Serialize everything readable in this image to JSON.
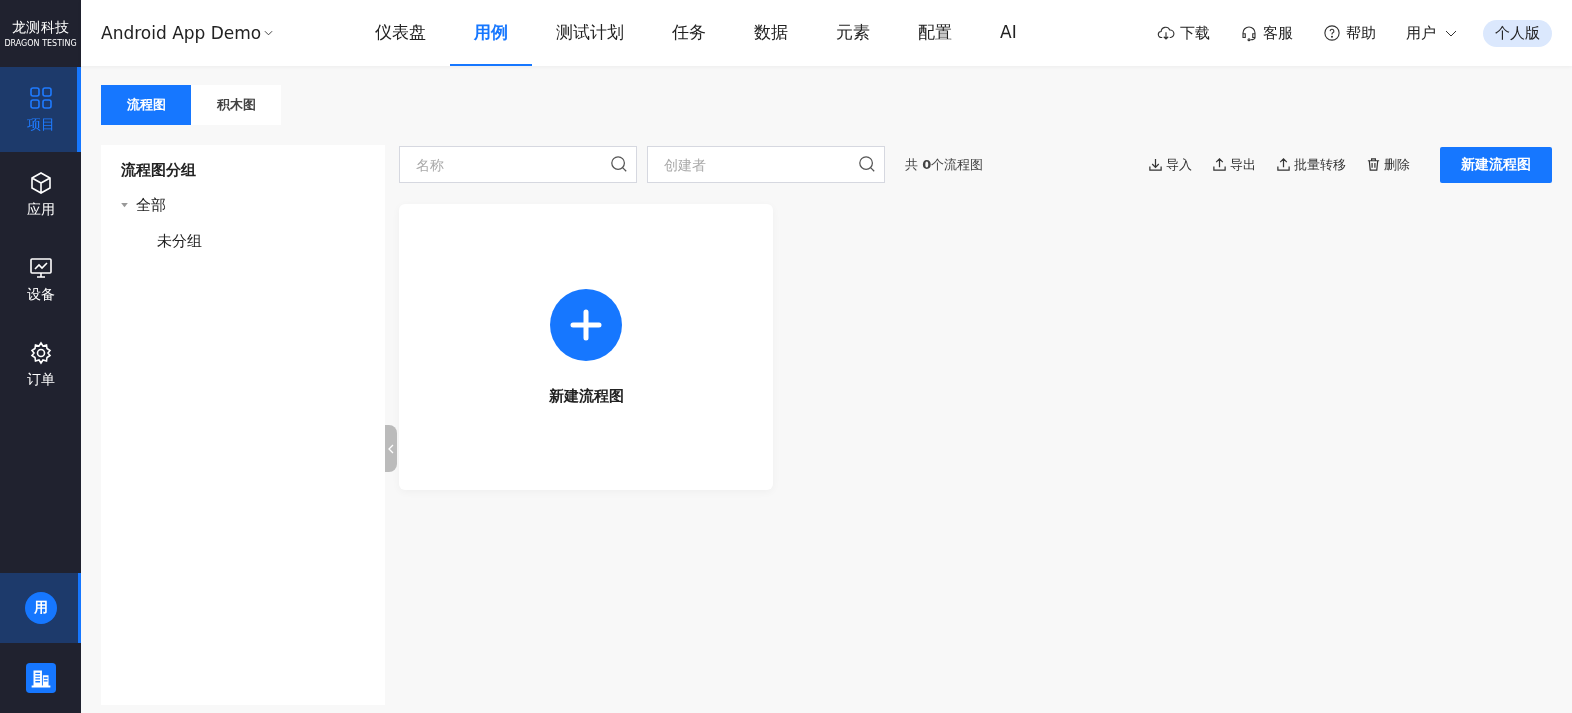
{
  "logo": {
    "name": "龙测科技",
    "subtitle": "DRAGON TESTING"
  },
  "sidebar": {
    "items": [
      {
        "label": "项目",
        "kind": "grid",
        "selected": true
      },
      {
        "label": "应用",
        "kind": "cube",
        "selected": false
      },
      {
        "label": "设备",
        "kind": "monitor",
        "selected": false
      },
      {
        "label": "订单",
        "kind": "gear",
        "selected": false
      }
    ],
    "avatar": {
      "text": "用",
      "selected": true
    }
  },
  "header": {
    "project": "Android App Demo",
    "nav": [
      {
        "label": "仪表盘",
        "selected": false
      },
      {
        "label": "用例",
        "selected": true
      },
      {
        "label": "测试计划",
        "selected": false
      },
      {
        "label": "任务",
        "selected": false
      },
      {
        "label": "数据",
        "selected": false
      },
      {
        "label": "元素",
        "selected": false
      },
      {
        "label": "配置",
        "selected": false
      },
      {
        "label": "AI",
        "selected": false
      }
    ],
    "actions": [
      {
        "label": "下载",
        "kind": "cloud"
      },
      {
        "label": "客服",
        "kind": "headset"
      },
      {
        "label": "帮助",
        "kind": "help"
      }
    ],
    "user": "用户",
    "plan": "个人版"
  },
  "view_tabs": [
    {
      "label": "流程图",
      "selected": true
    },
    {
      "label": "积木图",
      "selected": false
    }
  ],
  "groups": {
    "title": "流程图分组",
    "tree": [
      {
        "label": "全部",
        "expanded": true,
        "children": [
          {
            "label": "未分组"
          }
        ]
      }
    ]
  },
  "filters": [
    {
      "placeholder": "名称"
    },
    {
      "placeholder": "创建者"
    }
  ],
  "count": "共 **0**个流程图",
  "toolbar": [
    {
      "label": "导入",
      "kind": "download"
    },
    {
      "label": "导出",
      "kind": "upload"
    },
    {
      "label": "批量转移",
      "kind": "upload"
    },
    {
      "label": "删除",
      "kind": "trash"
    }
  ],
  "primary_button": "新建流程图",
  "new_card": {
    "label": "新建流程图"
  }
}
